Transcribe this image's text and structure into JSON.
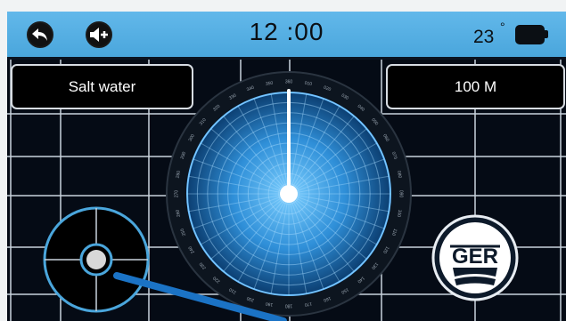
{
  "toolbar": {
    "back_icon": "back-arrow-icon",
    "volume_icon": "volume-up-icon",
    "time": "12 :00",
    "temperature": "23",
    "degree_symbol": "°",
    "battery_icon": "battery-icon"
  },
  "settings": {
    "medium": "Salt water",
    "range": "100 M"
  },
  "compass": {
    "needle_angle_deg": 0,
    "tick_labels": [
      "360",
      "010",
      "020",
      "030",
      "040",
      "050",
      "060",
      "070",
      "080",
      "090",
      "100",
      "110",
      "120",
      "130",
      "140",
      "150",
      "160",
      "170",
      "180",
      "190",
      "200",
      "210",
      "220",
      "230",
      "240",
      "250",
      "260",
      "270",
      "280",
      "290",
      "300",
      "310",
      "320",
      "330",
      "340",
      "350"
    ]
  },
  "logo": {
    "text": "GER"
  },
  "colors": {
    "topbar": "#55ade2",
    "background": "#050b15",
    "grid": "#c9d3dd",
    "radar_center": "#6fc4ff",
    "radar_edge": "#0c3f72",
    "pointer": "#1b73c5"
  }
}
